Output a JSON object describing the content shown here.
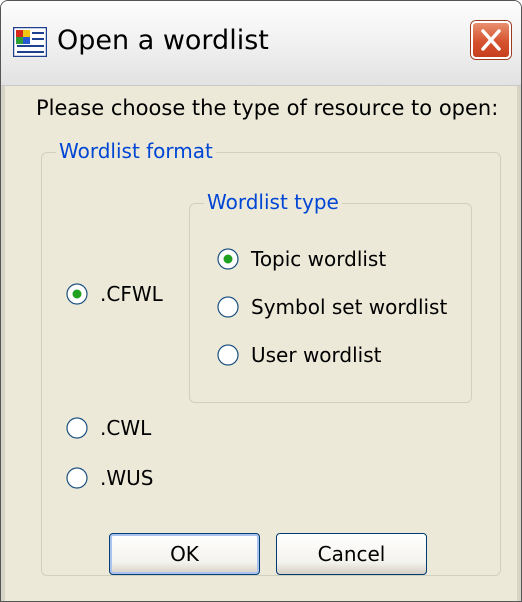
{
  "window": {
    "title": "Open a wordlist",
    "app_icon": "wordlist-app-icon",
    "close_icon": "close-icon"
  },
  "dialog": {
    "prompt": "Please choose the type of resource to open:"
  },
  "wordlist_format": {
    "label": "Wordlist format",
    "options": [
      {
        "label": ".CFWL",
        "checked": true
      },
      {
        "label": ".CWL",
        "checked": false
      },
      {
        "label": ".WUS",
        "checked": false
      }
    ]
  },
  "wordlist_type": {
    "label": "Wordlist type",
    "options": [
      {
        "label": "Topic wordlist",
        "checked": true
      },
      {
        "label": "Symbol set wordlist",
        "checked": false
      },
      {
        "label": "User wordlist",
        "checked": false
      }
    ]
  },
  "buttons": {
    "ok": "OK",
    "cancel": "Cancel"
  },
  "colors": {
    "group_label": "#0046d5",
    "radio_dot": "#21a121",
    "close_button": "#d6532f"
  }
}
